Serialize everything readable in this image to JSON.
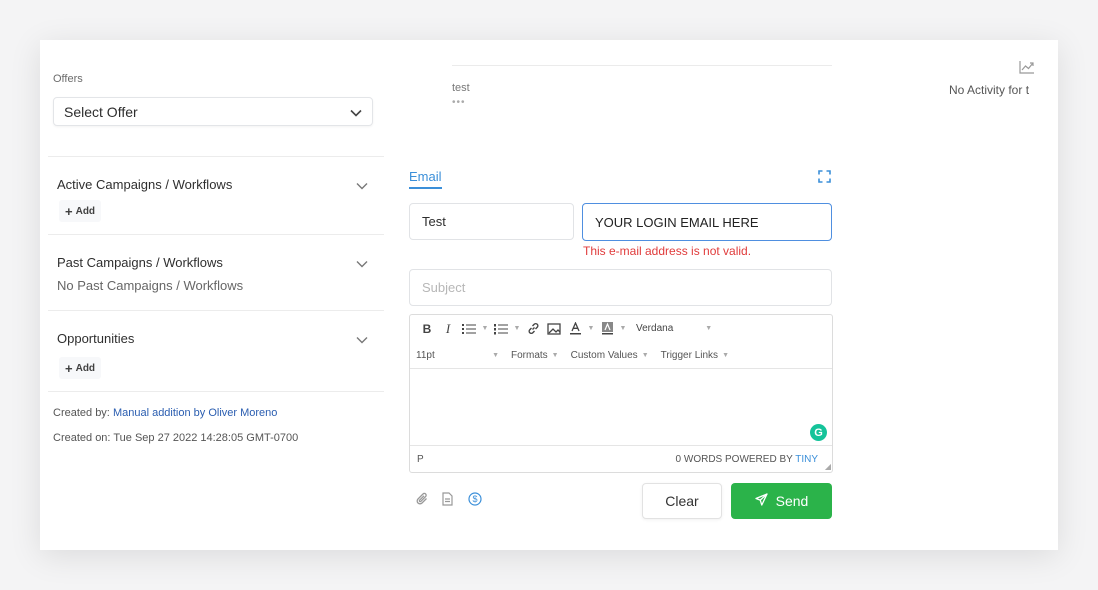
{
  "left": {
    "offers_label": "Offers",
    "select_offer": "Select Offer",
    "sections": [
      {
        "title": "Active Campaigns / Workflows",
        "add_label": "Add"
      },
      {
        "title": "Past Campaigns / Workflows",
        "empty_text": "No Past Campaigns / Workflows"
      },
      {
        "title": "Opportunities",
        "add_label": "Add"
      }
    ],
    "created_by_label": "Created by:",
    "created_by_value": "Manual addition by Oliver Moreno",
    "created_on": "Created on: Tue Sep 27 2022 14:28:05 GMT-0700"
  },
  "conversation": {
    "preview_text": "test",
    "more_dots": "•••"
  },
  "composer": {
    "tab_label": "Email",
    "from_value": "Test",
    "to_value": "YOUR LOGIN EMAIL HERE",
    "error_text": "This e-mail address is not valid.",
    "subject_placeholder": "Subject",
    "toolbar": {
      "bold": "B",
      "italic": "I",
      "font_family": "Verdana",
      "font_size": "11pt",
      "formats": "Formats",
      "custom_values": "Custom Values",
      "trigger_links": "Trigger Links"
    },
    "status_path": "P",
    "word_count": "0 WORDS POWERED BY",
    "powered_by": "TINY",
    "clear_label": "Clear",
    "send_label": "Send"
  },
  "activity": {
    "text": "No Activity for t"
  },
  "colors": {
    "accent": "#3b8fd9",
    "error": "#e03b3b",
    "send": "#2bb34a",
    "link": "#2a5db0"
  }
}
